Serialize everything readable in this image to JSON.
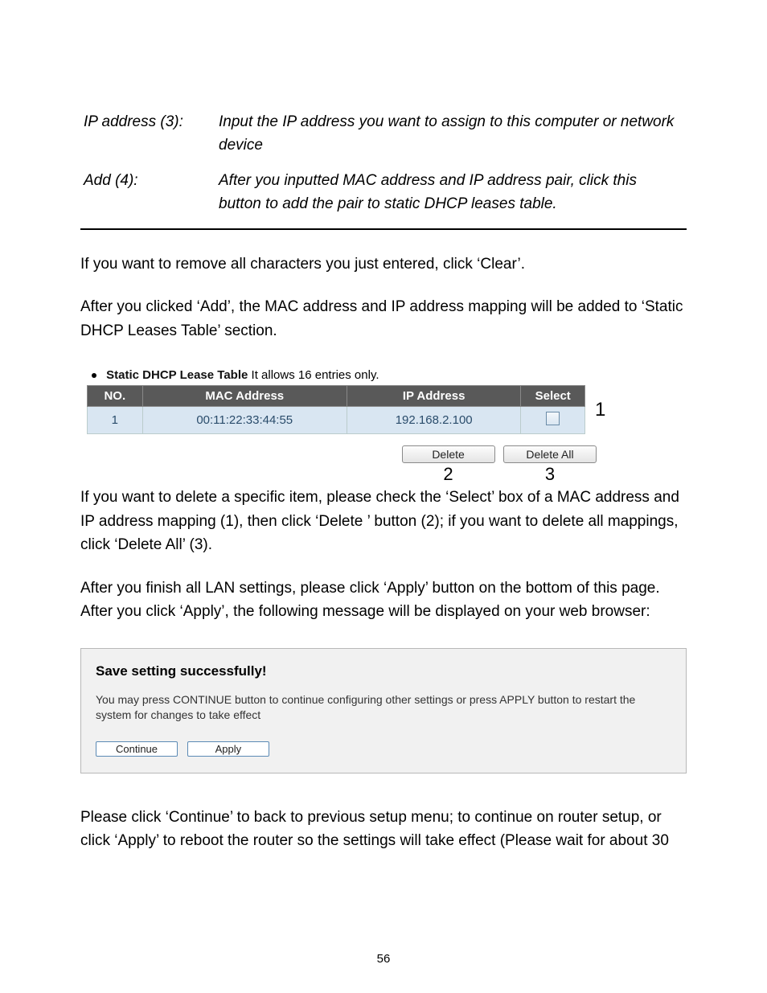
{
  "definitions": [
    {
      "term": "IP address (3):",
      "desc": "Input the IP address you want to assign to this computer or network device"
    },
    {
      "term": "Add (4):",
      "desc": "After you inputted MAC address and IP address pair, click this button to add the pair to static DHCP leases table."
    }
  ],
  "paragraphs": {
    "p1": "If you want to remove all characters you just entered, click ‘Clear’.",
    "p2": "After you clicked ‘Add’, the MAC address and IP address mapping will be added to ‘Static DHCP Leases Table’ section.",
    "p3": "If you want to delete a specific item, please check the ‘Select’ box of a MAC address and IP address mapping (1), then click ‘Delete ’ button (2); if you want to delete all mappings, click ‘Delete All’ (3).",
    "p4": "After you finish all LAN settings, please click ‘Apply’ button on the bottom of this page. After you click ‘Apply’, the following message will be displayed on your web browser:",
    "p5": "Please click ‘Continue’ to back to previous setup menu; to continue on router setup, or click ‘Apply’ to reboot the router so the settings will take effect (Please wait for about 30"
  },
  "lease": {
    "title_bold": "Static DHCP Lease Table",
    "title_rest": " It allows 16 entries only.",
    "headers": {
      "no": "NO.",
      "mac": "MAC Address",
      "ip": "IP Address",
      "select": "Select"
    },
    "row": {
      "no": "1",
      "mac": "00:11:22:33:44:55",
      "ip": "192.168.2.100"
    },
    "marker1": "1",
    "buttons": {
      "delete": "Delete",
      "delete_all": "Delete All"
    },
    "marker2": "2",
    "marker3": "3"
  },
  "save": {
    "header": "Save setting successfully!",
    "message": "You may press CONTINUE button to continue configuring other settings or press APPLY button to restart the system for changes to take effect",
    "continue": "Continue",
    "apply": "Apply"
  },
  "page_number": "56"
}
